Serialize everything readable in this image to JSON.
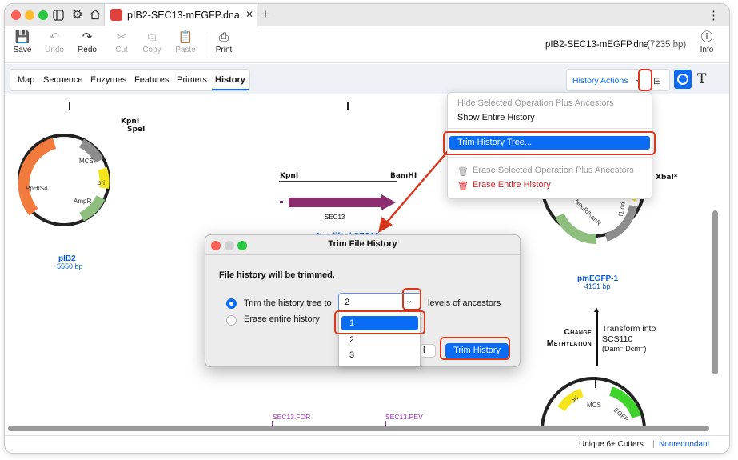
{
  "window": {
    "tab_title": "pIB2-SEC13-mEGFP.dna",
    "new_tab": "+",
    "more": "⋮"
  },
  "toolbar": {
    "save": "Save",
    "undo": "Undo",
    "redo": "Redo",
    "cut": "Cut",
    "copy": "Copy",
    "paste": "Paste",
    "print": "Print",
    "info": "Info",
    "file_name": "pIB2-SEC13-mEGFP.dna",
    "file_size": "(7235 bp)"
  },
  "view_tabs": [
    "Map",
    "Sequence",
    "Enzymes",
    "Features",
    "Primers",
    "History"
  ],
  "active_view_tab": "History",
  "history_actions": "History Actions",
  "history_menu": {
    "items": [
      "Hide Selected Operation Plus Ancestors",
      "Show Entire History",
      "Trim History Tree...",
      "Erase Selected Operation Plus Ancestors",
      "Erase Entire History"
    ]
  },
  "canvas": {
    "left_plasmid": {
      "name": "pIB2",
      "size": "5550 bp",
      "sites": [
        "KpnI",
        "SpeI"
      ],
      "features": [
        "MCS",
        "ori",
        "AmpR",
        "PpHIS4"
      ]
    },
    "insert": {
      "sites": [
        "KpnI",
        "BamHI"
      ],
      "feature": "SEC13",
      "name": "Amplified SEC13"
    },
    "right_plasmid": {
      "name": "pmEGFP-1",
      "size": "4151 bp",
      "sites": [
        "XbaI*"
      ],
      "features": [
        "NeoR/KanR",
        "f1 ori"
      ]
    },
    "operation": {
      "left_line1": "Change",
      "left_line2": "Methylation",
      "right_line1": "Transform into",
      "right_line2": "SCS110",
      "right_line3": "(Dam⁻ Dcm⁻)"
    },
    "bottom_plasmid": {
      "features": [
        "ori",
        "MCS",
        "EGFP"
      ]
    },
    "primers": [
      "SEC13.FOR",
      "SEC13.REV"
    ]
  },
  "dialog": {
    "title": "Trim File History",
    "heading": "File history will be trimmed.",
    "option_trim": "Trim the history tree to",
    "option_erase": "Erase entire history",
    "levels_value": "2",
    "levels_suffix": "levels of ancestors",
    "cancel_partial": "l",
    "trim_button": "Trim History"
  },
  "dropdown": {
    "options": [
      "1",
      "2",
      "3"
    ],
    "highlighted": "1"
  },
  "statusbar": {
    "cutters": "Unique 6+ Cutters",
    "separator": "|",
    "mode": "Nonredundant"
  },
  "colors": {
    "accent": "#0a6cf5",
    "highlight_red": "#d9381e",
    "menu_danger": "#d4232a"
  }
}
